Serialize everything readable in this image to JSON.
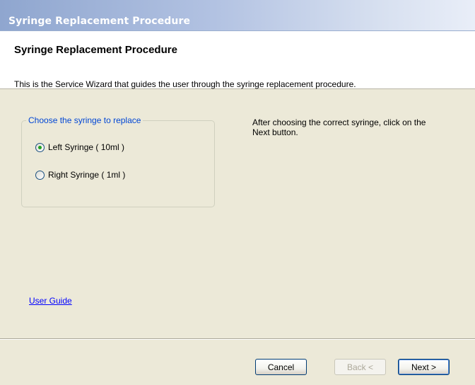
{
  "window": {
    "title": "Syringe Replacement Procedure"
  },
  "header": {
    "title": "Syringe Replacement Procedure",
    "description": "This is the Service Wizard that guides the user through the syringe replacement procedure."
  },
  "group": {
    "legend": "Choose the syringe to replace",
    "options": [
      {
        "label": "Left Syringe ( 10ml )",
        "checked": true
      },
      {
        "label": "Right Syringe ( 1ml )",
        "checked": false
      }
    ]
  },
  "hint": "After choosing the correct syringe, click on the Next button.",
  "links": {
    "user_guide": "User Guide"
  },
  "buttons": {
    "cancel": "Cancel",
    "back": "Back <",
    "next": "Next >"
  },
  "colors": {
    "titlebar_start": "#8fa6cf",
    "legend": "#0046d5",
    "link": "#0000ff",
    "radio_dot": "#21a121"
  }
}
